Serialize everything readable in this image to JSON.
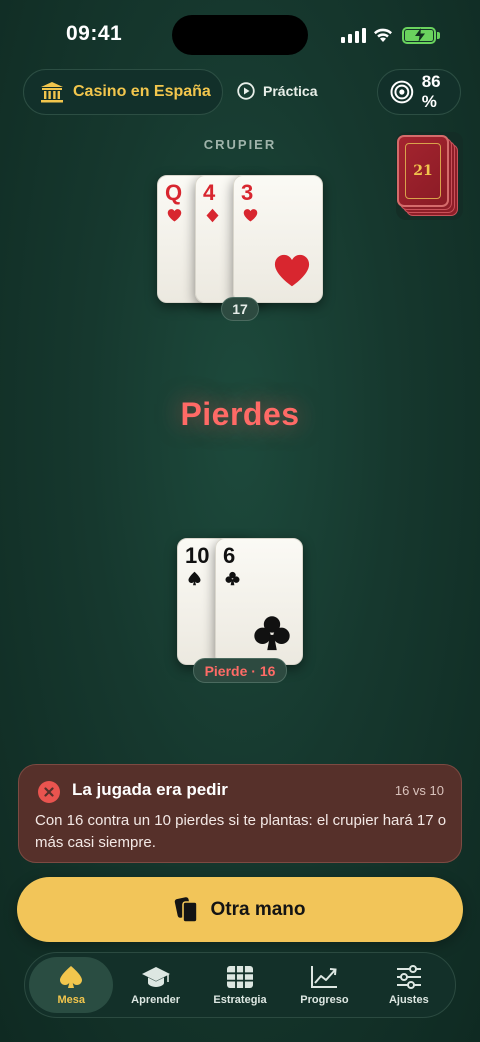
{
  "status": {
    "time": "09:41"
  },
  "header": {
    "casino_label": "Casino en España",
    "mode_label": "Práctica",
    "accuracy": "86 %"
  },
  "deck": {
    "label": "21"
  },
  "dealer": {
    "label": "CRUPIER",
    "cards": [
      {
        "rank": "Q",
        "suit": "hearts"
      },
      {
        "rank": "4",
        "suit": "diamonds"
      },
      {
        "rank": "3",
        "suit": "hearts"
      }
    ],
    "total": "17"
  },
  "result": {
    "text": "Pierdes"
  },
  "player": {
    "cards": [
      {
        "rank": "10",
        "suit": "spades"
      },
      {
        "rank": "6",
        "suit": "clubs"
      }
    ],
    "status": "Pierde · 16"
  },
  "feedback": {
    "title": "La jugada era pedir",
    "meta": "16 vs 10",
    "body": "Con 16 contra un 10 pierdes si te plantas: el crupier hará 17 o más casi siempre."
  },
  "action": {
    "label": "Otra mano"
  },
  "tabs": [
    {
      "label": "Mesa",
      "icon": "spade-icon",
      "active": true
    },
    {
      "label": "Aprender",
      "icon": "graduation-cap-icon",
      "active": false
    },
    {
      "label": "Estrategia",
      "icon": "grid-table-icon",
      "active": false
    },
    {
      "label": "Progreso",
      "icon": "chart-line-icon",
      "active": false
    },
    {
      "label": "Ajustes",
      "icon": "sliders-icon",
      "active": false
    }
  ],
  "colors": {
    "accent": "#f2c559",
    "loss": "#ff6a66",
    "felt": "#16382e"
  }
}
